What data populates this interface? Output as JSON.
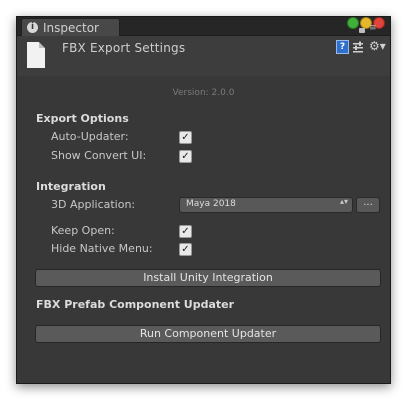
{
  "tab": {
    "title": "Inspector",
    "icon": "info-icon"
  },
  "header": {
    "title": "FBX Export Settings",
    "icons": [
      "help-icon",
      "preset-icon",
      "gear-icon"
    ]
  },
  "version": "Version: 2.0.0",
  "export_options": {
    "title": "Export Options",
    "auto_updater": {
      "label": "Auto-Updater:",
      "checked": true
    },
    "show_convert_ui": {
      "label": "Show Convert UI:",
      "checked": true
    }
  },
  "integration": {
    "title": "Integration",
    "app_label": "3D Application:",
    "app_value": "Maya 2018",
    "browse_label": "...",
    "keep_open": {
      "label": "Keep Open:",
      "checked": true
    },
    "hide_native_menu": {
      "label": "Hide Native Menu:",
      "checked": true
    },
    "install_button": "Install Unity Integration"
  },
  "prefab_updater": {
    "title": "FBX Prefab Component Updater",
    "run_button": "Run Component Updater"
  },
  "glyphs": {
    "check": "✓",
    "arrows": "▴▾",
    "gear": "⚙▾",
    "help": "?",
    "info": "i"
  },
  "colors": {
    "panel": "#383838",
    "tabbar": "#262626",
    "button": "#5a5a5a",
    "help_blue": "#2f6fce"
  }
}
